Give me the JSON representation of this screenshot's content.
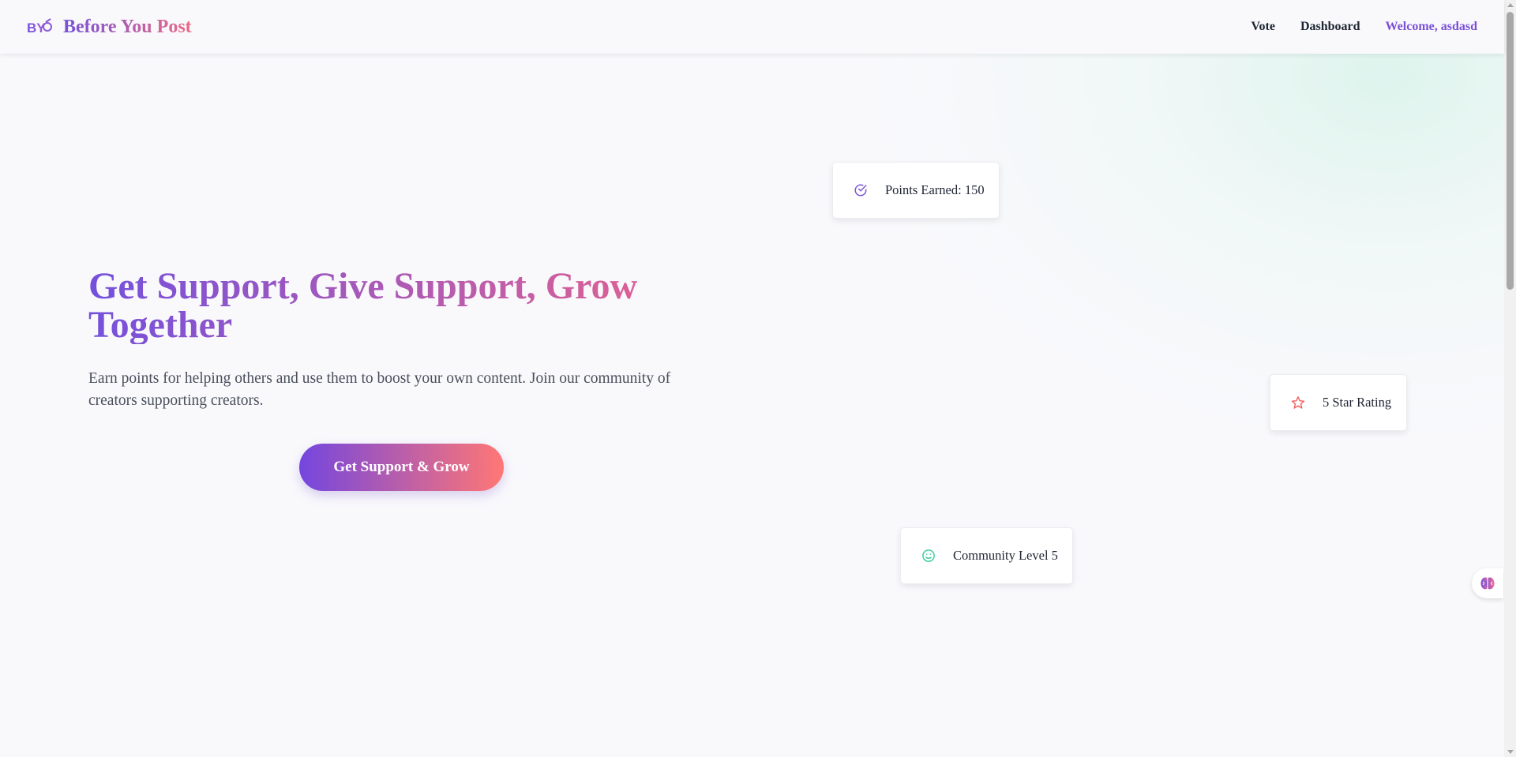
{
  "header": {
    "brand": "Before You Post",
    "logo_icon": "byp-logo-icon",
    "nav": {
      "vote": "Vote",
      "dashboard": "Dashboard",
      "welcome": "Welcome, asdasd"
    }
  },
  "hero": {
    "title": "Get Support, Give Support, Grow Together",
    "subtitle": "Earn points for helping others and use them to boost your own content. Join our community of creators supporting creators.",
    "cta_label": "Get Support & Grow"
  },
  "cards": {
    "points": {
      "label": "Points Earned: 150",
      "icon": "check-circle-icon",
      "icon_color": "#7a55d8"
    },
    "rating": {
      "label": "5 Star Rating",
      "icon": "star-icon",
      "icon_color": "#f06a6a"
    },
    "community": {
      "label": "Community Level 5",
      "icon": "smile-icon",
      "icon_color": "#3fcf9c"
    }
  },
  "colors": {
    "brand_start": "#7451dc",
    "brand_end": "#e4628f",
    "cta_start": "#7446de",
    "cta_end": "#ff7775",
    "background": "#f9f9fc"
  },
  "widget": {
    "icon": "brain-icon"
  }
}
